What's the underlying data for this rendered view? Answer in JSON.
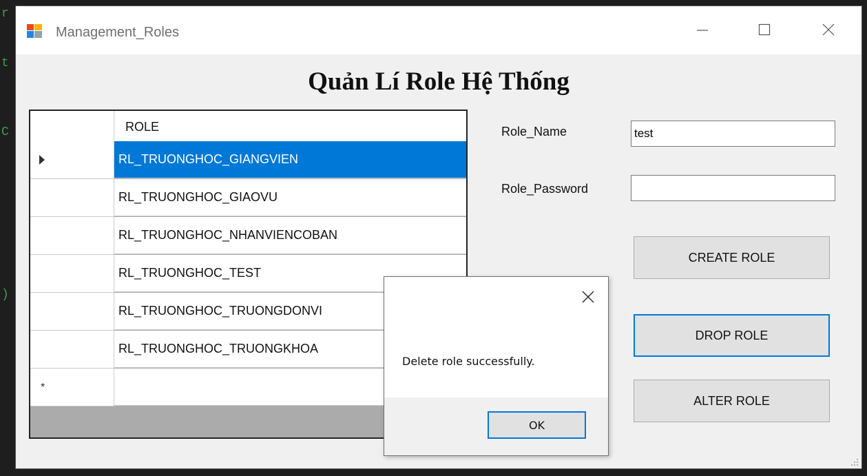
{
  "window": {
    "title": "Management_Roles"
  },
  "form": {
    "heading": "Quản Lí Role Hệ Thống",
    "role_name_label": "Role_Name",
    "role_name_value": "test",
    "role_password_label": "Role_Password",
    "role_password_value": "",
    "create_label": "CREATE ROLE",
    "drop_label": "DROP ROLE",
    "alter_label": "ALTER ROLE"
  },
  "grid": {
    "column": "ROLE",
    "rows": [
      "RL_TRUONGHOC_GIANGVIEN",
      "RL_TRUONGHOC_GIAOVU",
      "RL_TRUONGHOC_NHANVIENCOBAN",
      "RL_TRUONGHOC_TEST",
      "RL_TRUONGHOC_TRUONGDONVI",
      "RL_TRUONGHOC_TRUONGKHOA"
    ],
    "new_row_marker": "*"
  },
  "dialog": {
    "message": "Delete role successfully.",
    "ok_label": "OK"
  },
  "colors": {
    "selection": "#0078d7",
    "focus_border": "#0078d7",
    "window_bg": "#f0f0f0"
  }
}
